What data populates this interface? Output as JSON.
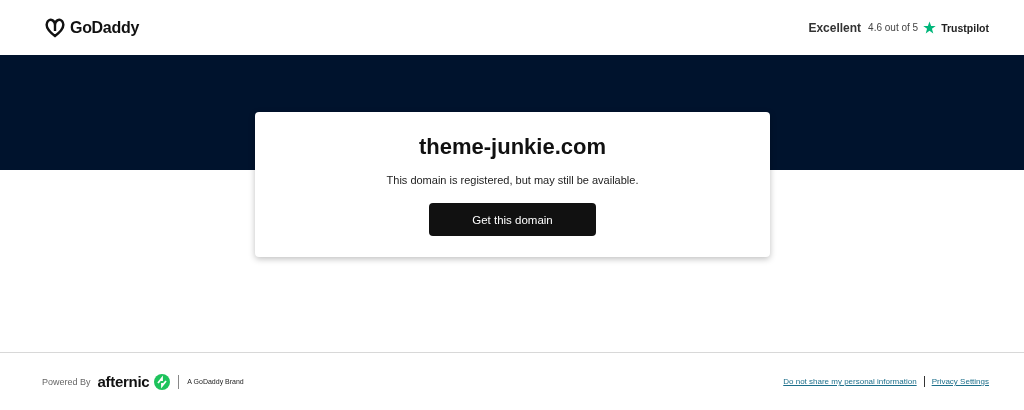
{
  "header": {
    "logo": "GoDaddy",
    "rating": {
      "label": "Excellent",
      "score": "4.6 out of 5",
      "brand": "Trustpilot"
    }
  },
  "card": {
    "domain": "theme-junkie.com",
    "message": "This domain is registered, but may still be available.",
    "button": "Get this domain"
  },
  "footer": {
    "powered_by": "Powered By",
    "partner": "afternic",
    "tagline": "A GoDaddy Brand",
    "links": [
      "Do not share my personal information",
      "Privacy Settings"
    ]
  }
}
